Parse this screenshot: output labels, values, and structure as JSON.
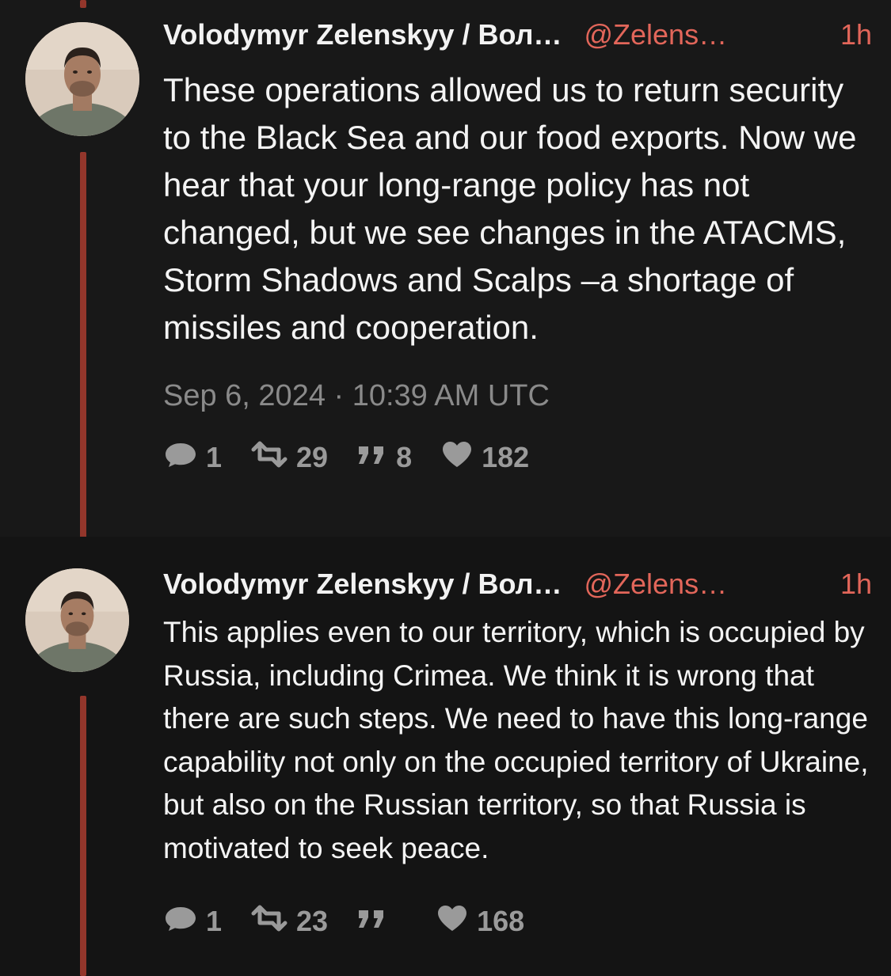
{
  "tweets": [
    {
      "author_name": "Volodymyr Zelenskyy / Вол…",
      "handle": "@Zelens…",
      "time_ago": "1h",
      "text": "These operations allowed us to return security to the Black Sea and our food exports. Now we hear that your long-range policy has not changed, but we see changes in the ATACMS, Storm Shadows and Scalps –a shortage of missiles and cooperation.",
      "date": "Sep 6, 2024 · 10:39 AM UTC",
      "stats": {
        "replies": "1",
        "retweets": "29",
        "quotes": "8",
        "likes": "182"
      }
    },
    {
      "author_name": "Volodymyr Zelenskyy / Вол…",
      "handle": "@Zelens…",
      "time_ago": "1h",
      "text": "This applies even to our territory, which is occupied by Russia, including Crimea. We think it is wrong that there are such steps. We need to have this long-range capability not only on the occupied territory of Ukraine, but also on the Russian territory, so that Russia is motivated to seek peace.",
      "stats": {
        "replies": "1",
        "retweets": "23",
        "quotes": "",
        "likes": "168"
      }
    }
  ],
  "icons": {
    "reply": "comment-icon",
    "retweet": "retweet-icon",
    "quote": "quote-icon",
    "like": "heart-icon"
  },
  "colors": {
    "background": "#121212",
    "accent": "#e2665a",
    "thread_line": "#93362b",
    "muted": "#8a8a8a"
  }
}
